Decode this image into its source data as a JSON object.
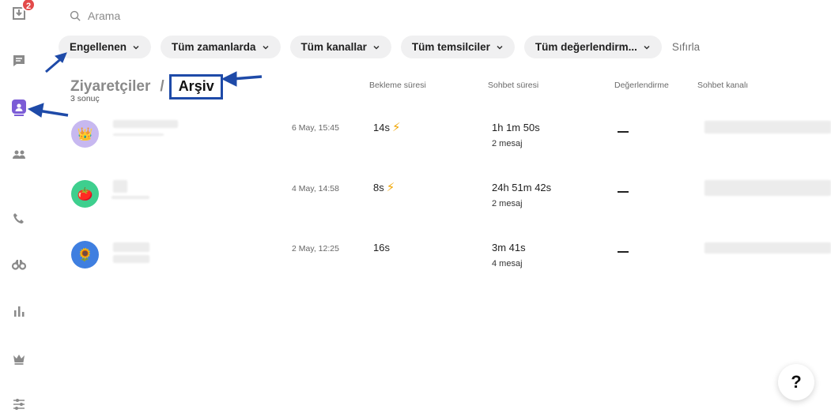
{
  "sidebar": {
    "inbox_badge": "2",
    "items": [
      {
        "icon": "inbox-icon"
      },
      {
        "icon": "chat-icon"
      },
      {
        "icon": "visitors-icon"
      },
      {
        "icon": "team-icon"
      },
      {
        "icon": "phone-icon"
      },
      {
        "icon": "binoculars-icon"
      },
      {
        "icon": "reports-icon"
      },
      {
        "icon": "crown-icon"
      },
      {
        "icon": "settings-sliders-icon"
      }
    ],
    "active_color": "#7b5cd6"
  },
  "search": {
    "placeholder": "Arama"
  },
  "filters": {
    "chips": [
      "Engellenen",
      "Tüm zamanlarda",
      "Tüm kanallar",
      "Tüm temsilciler",
      "Tüm değerlendirm..."
    ],
    "reset": "Sıfırla"
  },
  "breadcrumb": {
    "root": "Ziyaretçiler",
    "separator": "/",
    "current": "Arşiv"
  },
  "result_count": "3 sonuç",
  "columns": {
    "wait": "Bekleme süresi",
    "duration": "Sohbet süresi",
    "rating": "Değerlendirme",
    "channel": "Sohbet kanalı"
  },
  "rows": [
    {
      "avatar": "👑",
      "avatar_bg": "#c7b8f0",
      "date": "6 May, 15:45",
      "wait": "14s",
      "fast": "⚡",
      "duration": "1h 1m 50s",
      "messages": "2 mesaj",
      "rating": "—"
    },
    {
      "avatar": "🍅",
      "avatar_bg": "#3ecf8e",
      "date": "4 May, 14:58",
      "wait": "8s",
      "fast": "⚡",
      "duration": "24h 51m 42s",
      "messages": "2 mesaj",
      "rating": "—"
    },
    {
      "avatar": "🌻",
      "avatar_bg": "#3f7fe0",
      "date": "2 May, 12:25",
      "wait": "16s",
      "fast": "",
      "duration": "3m 41s",
      "messages": "4 mesaj",
      "rating": "—"
    }
  ],
  "help": "?",
  "annotation_color": "#1e4aa8"
}
